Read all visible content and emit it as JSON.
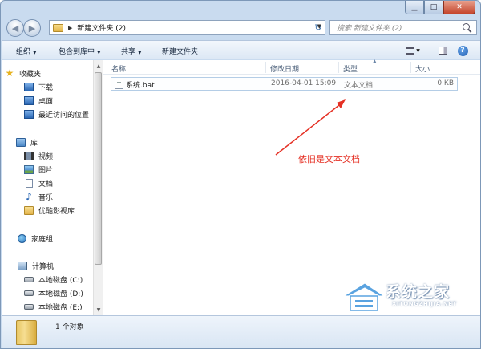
{
  "window": {
    "minimize_glyph": "▁",
    "maximize_glyph": "□",
    "close_glyph": "✕"
  },
  "address": {
    "path": "新建文件夹 (2)",
    "search_placeholder": "搜索 新建文件夹 (2)"
  },
  "toolbar": {
    "items": [
      {
        "label": "组织"
      },
      {
        "label": "包含到库中"
      },
      {
        "label": "共享"
      },
      {
        "label": "新建文件夹"
      }
    ],
    "help_glyph": "?"
  },
  "sidebar": {
    "favorites": {
      "label": "收藏夹",
      "items": [
        {
          "label": "下载"
        },
        {
          "label": "桌面"
        },
        {
          "label": "最近访问的位置"
        }
      ]
    },
    "libraries": {
      "label": "库",
      "items": [
        {
          "label": "视频"
        },
        {
          "label": "图片"
        },
        {
          "label": "文档"
        },
        {
          "label": "音乐"
        },
        {
          "label": "优酷影视库"
        }
      ]
    },
    "homegroup": {
      "label": "家庭组"
    },
    "computer": {
      "label": "计算机",
      "items": [
        {
          "label": "本地磁盘 (C:)"
        },
        {
          "label": "本地磁盘 (D:)"
        },
        {
          "label": "本地磁盘 (E:)"
        }
      ]
    }
  },
  "columns": {
    "name": "名称",
    "modified": "修改日期",
    "type": "类型",
    "size": "大小"
  },
  "files": [
    {
      "name": "系统.bat",
      "modified": "2016-04-01 15:09",
      "type": "文本文档",
      "size": "0 KB"
    }
  ],
  "annotation": {
    "text": "依旧是文本文档",
    "color": "#e53024"
  },
  "watermark": {
    "name": "系统之家",
    "site": "XITONGZHIJIA.NET"
  },
  "details": {
    "count_text": "1 个对象"
  },
  "colors": {
    "window_frame": "#c9dbef",
    "accent": "#2a67b4"
  }
}
